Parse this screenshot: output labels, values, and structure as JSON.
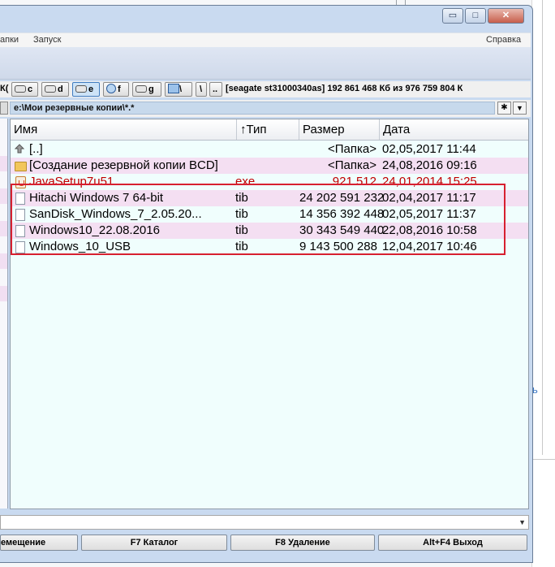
{
  "window": {
    "caption_buttons": {
      "minimize": "▭",
      "maximize": "□",
      "close": "✕"
    }
  },
  "menu": {
    "items": [
      "апки",
      "Запуск"
    ],
    "help": "Справка"
  },
  "drivebar": {
    "prefix": "К(",
    "drives": [
      {
        "letter": "c",
        "active": false
      },
      {
        "letter": "d",
        "active": false
      },
      {
        "letter": "e",
        "active": true
      },
      {
        "letter": "f",
        "active": false
      },
      {
        "letter": "g",
        "active": false
      }
    ],
    "net_label": "\\",
    "root": "\\",
    "up": "..",
    "info": "[seagate st31000340as]  192 861 468 Кб из 976 759 804 К"
  },
  "path": {
    "value": "e:\\Мои резервные копии\\*.*",
    "star": "✱",
    "dropdown": "▼"
  },
  "columns": {
    "name": "Имя",
    "type": "↑Тип",
    "size": "Размер",
    "date": "Дата"
  },
  "files": [
    {
      "name": "[..]",
      "type": "",
      "size": "<Папка>",
      "date": "02,05,2017 11:44",
      "icon": "up-icon",
      "red": false,
      "alt": false
    },
    {
      "name": "[Создание резервной копии BCD]",
      "type": "",
      "size": "<Папка>",
      "date": "24,08,2016 09:16",
      "icon": "folder-icon",
      "red": false,
      "alt": true
    },
    {
      "name": "JavaSetup7u51",
      "type": "exe",
      "size": "921 512",
      "date": "24,01,2014 15:25",
      "icon": "java-icon",
      "red": true,
      "alt": false
    },
    {
      "name": "Hitachi Windows 7 64-bit",
      "type": "tib",
      "size": "24 202 591 232",
      "date": "02,04,2017 11:17",
      "icon": "file-icon",
      "red": false,
      "alt": true
    },
    {
      "name": "SanDisk_Windows_7_2.05.20...",
      "type": "tib",
      "size": "14 356 392 448",
      "date": "02,05,2017 11:37",
      "icon": "file-icon",
      "red": false,
      "alt": false
    },
    {
      "name": "Windows10_22.08.2016",
      "type": "tib",
      "size": "30 343 549 440",
      "date": "22,08,2016 10:58",
      "icon": "file-icon",
      "red": false,
      "alt": true
    },
    {
      "name": "Windows_10_USB",
      "type": "tib",
      "size": "9 143 500 288",
      "date": "12,04,2017 10:46",
      "icon": "file-icon",
      "red": false,
      "alt": false
    }
  ],
  "cmdline": {
    "dropdown": "▼"
  },
  "fkeys": {
    "move": "емещение",
    "mkdir": "F7 Каталог",
    "delete": "F8 Удаление",
    "exit": "Alt+F4 Выход"
  },
  "background": {
    "fragment": "ь"
  },
  "colors": {
    "panel_bg": "#f0fefd",
    "alt_row": "#f4dff2",
    "red_text": "#c00000",
    "highlight_box": "#d72030"
  }
}
